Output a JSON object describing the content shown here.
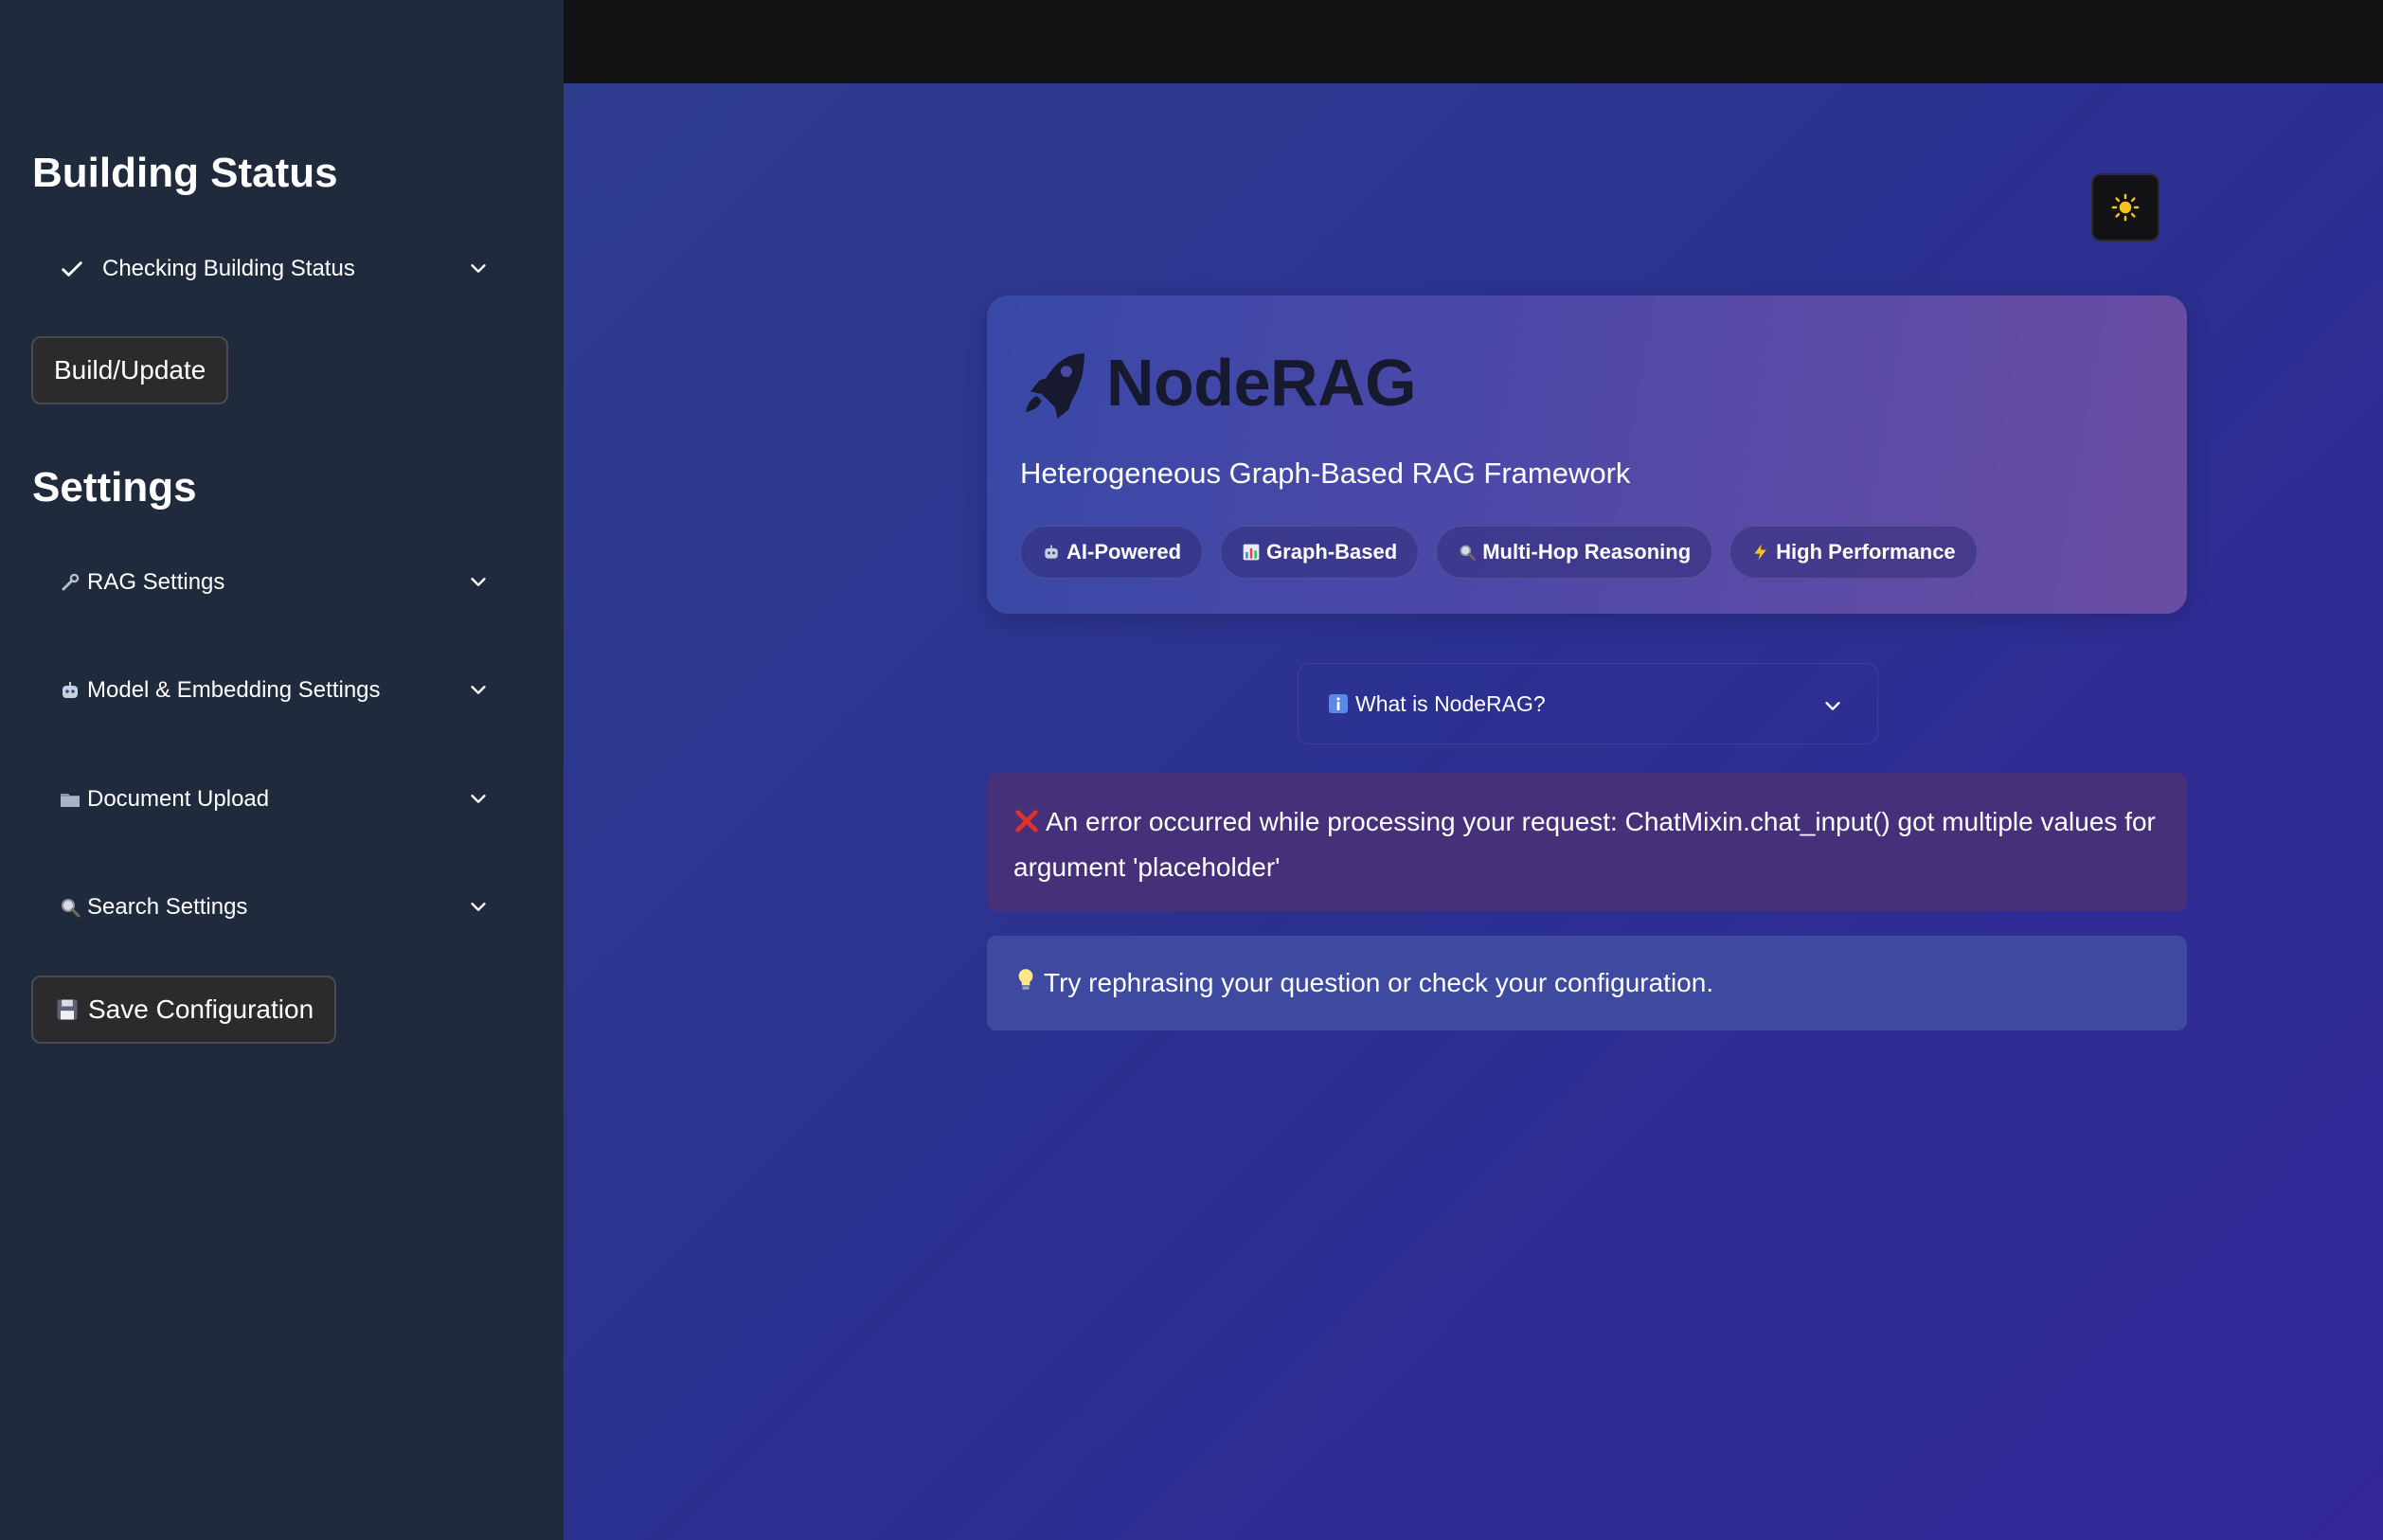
{
  "sidebar": {
    "building_status_heading": "Building Status",
    "status_expander": {
      "label": "Checking Building Status",
      "icon": "check-icon"
    },
    "build_button": "Build/Update",
    "settings_heading": "Settings",
    "settings_expanders": [
      {
        "label": "RAG Settings",
        "icon": "wrench-icon"
      },
      {
        "label": "Model & Embedding Settings",
        "icon": "robot-icon"
      },
      {
        "label": "Document Upload",
        "icon": "folder-icon"
      },
      {
        "label": "Search Settings",
        "icon": "magnifier-icon"
      }
    ],
    "save_button": "Save Configuration",
    "save_icon": "floppy-disk-icon"
  },
  "header": {
    "theme_toggle_icon": "sun-icon"
  },
  "hero": {
    "title": "NodeRAG",
    "title_icon": "rocket-icon",
    "subtitle": "Heterogeneous Graph-Based RAG Framework",
    "badges": [
      {
        "label": "AI-Powered",
        "icon": "robot-icon"
      },
      {
        "label": "Graph-Based",
        "icon": "bar-chart-icon"
      },
      {
        "label": "Multi-Hop Reasoning",
        "icon": "magnifier-icon"
      },
      {
        "label": "High Performance",
        "icon": "lightning-icon"
      }
    ]
  },
  "about_expander": {
    "label": "What is NodeRAG?",
    "icon": "info-icon"
  },
  "error_message": "An error occurred while processing your request: ChatMixin.chat_input() got multiple values for argument 'placeholder'",
  "info_message": "Try rephrasing your question or check your configuration.",
  "colors": {
    "sidebar_bg": "#1f2a3d",
    "main_bg": "#2b3190",
    "error_bg": "#46307a",
    "info_bg": "#3e4aa0",
    "error_icon": "#e0312b"
  }
}
